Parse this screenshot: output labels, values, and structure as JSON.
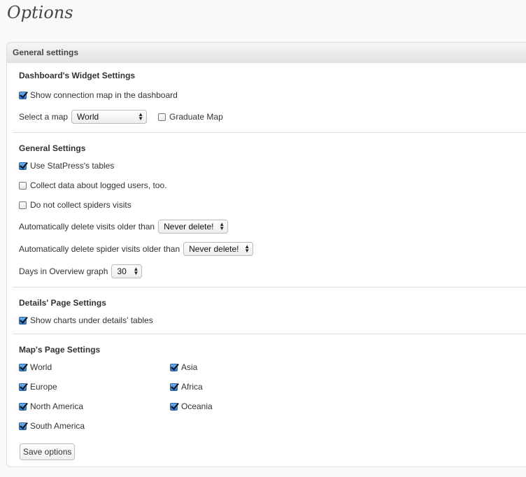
{
  "page_title": "Options",
  "panel": {
    "title": "General settings"
  },
  "dashboard": {
    "title": "Dashboard's Widget Settings",
    "show_map_label": "Show connection map in the dashboard",
    "show_map_checked": true,
    "select_map_label": "Select a map",
    "map_value": "World",
    "graduate_label": "Graduate Map",
    "graduate_checked": false
  },
  "general": {
    "title": "General Settings",
    "use_tables_label": "Use StatPress's tables",
    "use_tables_checked": true,
    "collect_logged_label": "Collect data about logged users, too.",
    "collect_logged_checked": false,
    "no_spiders_label": "Do not collect spiders visits",
    "no_spiders_checked": false,
    "delete_visits_label": "Automatically delete visits older than",
    "delete_visits_value": "Never delete!",
    "delete_spider_label": "Automatically delete spider visits older than",
    "delete_spider_value": "Never delete!",
    "days_label": "Days in Overview graph",
    "days_value": "30"
  },
  "details": {
    "title": "Details' Page Settings",
    "charts_label": "Show charts under details' tables",
    "charts_checked": true
  },
  "maps": {
    "title": "Map's Page Settings",
    "world": "World",
    "europe": "Europe",
    "north_america": "North America",
    "south_america": "South America",
    "asia": "Asia",
    "africa": "Africa",
    "oceania": "Oceania",
    "all_checked": true
  },
  "save_label": "Save options"
}
